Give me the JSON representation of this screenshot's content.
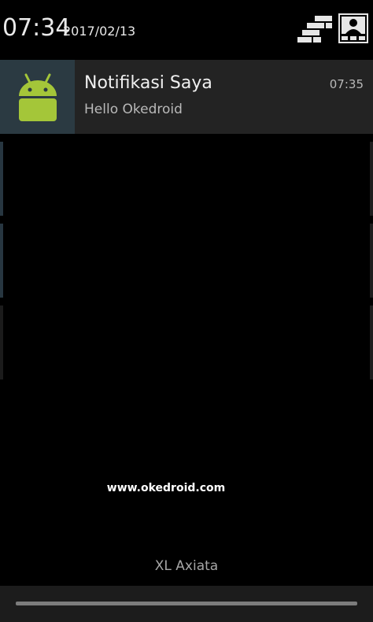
{
  "status_bar": {
    "time": "07:34",
    "date": "2017/02/13",
    "icons": [
      "quick-settings-icon",
      "profile-icon"
    ]
  },
  "notification": {
    "icon": "android-icon",
    "title": "Notifikasi Saya",
    "text": "Hello Okedroid",
    "time": "07:35"
  },
  "watermark": "www.okedroid.com",
  "carrier": "XL Axiata",
  "colors": {
    "background": "#000000",
    "notification_bg": "#232323",
    "icon_box_bg": "#2b3a42",
    "android_green": "#a4c639"
  }
}
